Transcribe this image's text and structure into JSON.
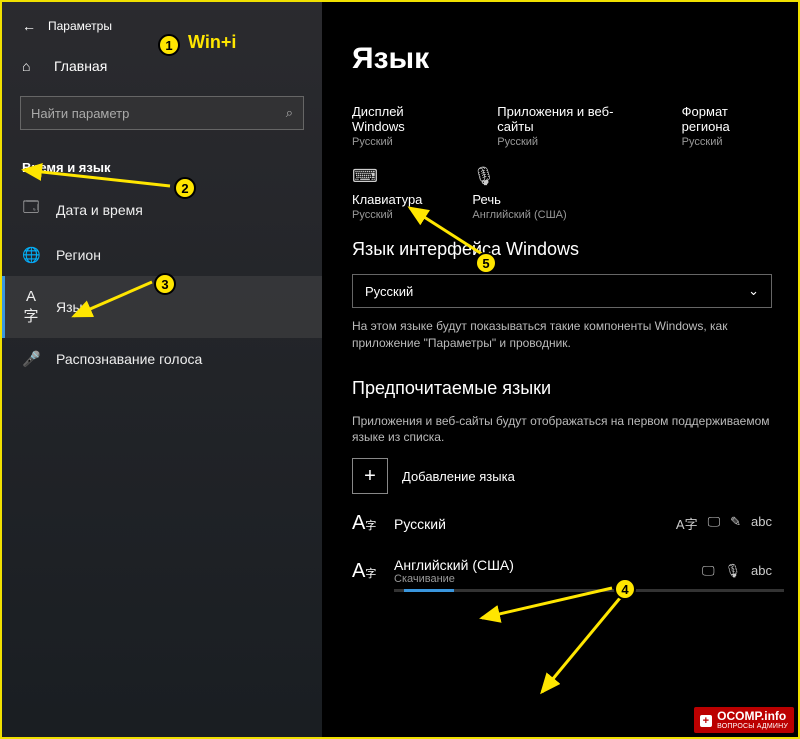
{
  "window": {
    "title": "Параметры",
    "home": "Главная",
    "search_placeholder": "Найти параметр",
    "section": "Время и язык"
  },
  "nav": {
    "date": "Дата и время",
    "region": "Регион",
    "language": "Язык",
    "speech": "Распознавание голоса"
  },
  "page": {
    "title": "Язык",
    "tiles": {
      "display": {
        "label": "Дисплей Windows",
        "sub": "Русский"
      },
      "apps": {
        "label": "Приложения и веб-сайты",
        "sub": "Русский"
      },
      "region": {
        "label": "Формат региона",
        "sub": "Русский"
      },
      "keyboard": {
        "label": "Клавиатура",
        "sub": "Русский"
      },
      "speech": {
        "label": "Речь",
        "sub": "Английский (США)"
      }
    },
    "ui_lang_heading": "Язык интерфейса Windows",
    "ui_lang_value": "Русский",
    "ui_lang_help": "На этом языке будут показываться такие компоненты Windows, как приложение \"Параметры\" и проводник.",
    "pref_heading": "Предпочитаемые языки",
    "pref_help": "Приложения и веб-сайты будут отображаться на первом поддерживаемом языке из списка.",
    "add_lang": "Добавление языка",
    "langs": {
      "ru": {
        "name": "Русский"
      },
      "en": {
        "name": "Английский (США)",
        "status": "Скачивание"
      }
    }
  },
  "annotations": {
    "shortcut": "Win+i",
    "m1": "1",
    "m2": "2",
    "m3": "3",
    "m4": "4",
    "m5": "5"
  },
  "watermark": {
    "top": "OCOMP.info",
    "sub": "ВОПРОСЫ АДМИНУ"
  }
}
